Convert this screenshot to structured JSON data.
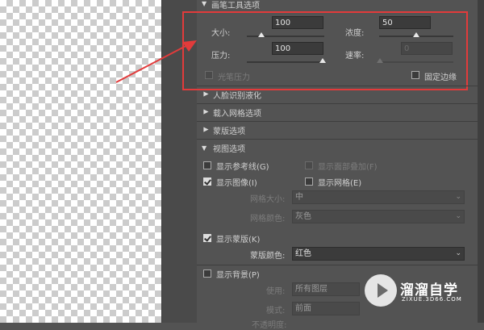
{
  "brush_tool_section": {
    "title": "画笔工具选项",
    "size": {
      "label": "大小:",
      "value": "100",
      "level_percent": 28
    },
    "density": {
      "label": "浓度:",
      "value": "50",
      "level_percent": 50
    },
    "pressure": {
      "label": "压力:",
      "value": "100",
      "level_percent": 100
    },
    "rate": {
      "label": "速率:",
      "value": "0",
      "level_percent": 0
    },
    "stylus_pressure": {
      "label": "光笔压力",
      "checked": false,
      "enabled": false
    },
    "pin_edges": {
      "label": "固定边缘",
      "checked": false
    }
  },
  "face_aware_section": {
    "title": "人脸识别液化"
  },
  "load_mesh_section": {
    "title": "载入网格选项"
  },
  "mask_options_section": {
    "title": "蒙版选项"
  },
  "view_options_section": {
    "title": "视图选项",
    "show_guides": {
      "label": "显示参考线(G)",
      "checked": false
    },
    "show_face_overlay": {
      "label": "显示面部叠加(F)",
      "checked": false,
      "enabled": false
    },
    "show_image": {
      "label": "显示图像(I)",
      "checked": true
    },
    "show_mesh": {
      "label": "显示网格(E)",
      "checked": false
    },
    "mesh_size": {
      "label": "网格大小:",
      "value": "中"
    },
    "mesh_color": {
      "label": "网格颜色:",
      "value": "灰色"
    },
    "show_mask": {
      "label": "显示蒙版(K)",
      "checked": true
    },
    "mask_color": {
      "label": "蒙版颜色:",
      "value": "红色"
    },
    "show_backdrop": {
      "label": "显示背景(P)",
      "checked": false
    },
    "use": {
      "label": "使用:",
      "value": "所有图层"
    },
    "mode": {
      "label": "模式:",
      "value": "前面"
    },
    "opacity": {
      "label": "不透明度:"
    }
  },
  "watermark": {
    "title": "溜溜自学",
    "subtitle": "ZIXUE.3D66.COM"
  },
  "colors": {
    "highlight": "#e23b3b",
    "panel_bg": "#535353"
  }
}
